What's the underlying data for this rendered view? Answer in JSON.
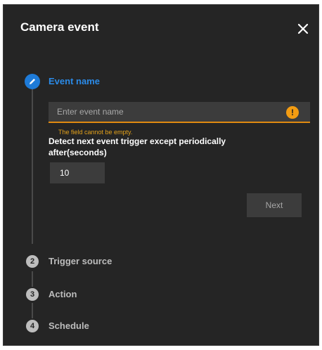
{
  "dialog": {
    "title": "Camera event",
    "close_icon": "close-icon"
  },
  "steps": [
    {
      "number": "",
      "label": "Event name",
      "state": "active",
      "icon": "pencil-icon"
    },
    {
      "number": "2",
      "label": "Trigger source",
      "state": "pending"
    },
    {
      "number": "3",
      "label": "Action",
      "state": "pending"
    },
    {
      "number": "4",
      "label": "Schedule",
      "state": "pending"
    }
  ],
  "event_name": {
    "value": "",
    "placeholder": "Enter event name",
    "error": "The field cannot be empty.",
    "warning_icon": "!"
  },
  "detect": {
    "label": "Detect next event trigger except periodically after(seconds)",
    "value": "10"
  },
  "next_label": "Next",
  "colors": {
    "background": "#252525",
    "accent": "#1e7bd8",
    "warning": "#f39c12",
    "field": "#3c3c3c"
  }
}
